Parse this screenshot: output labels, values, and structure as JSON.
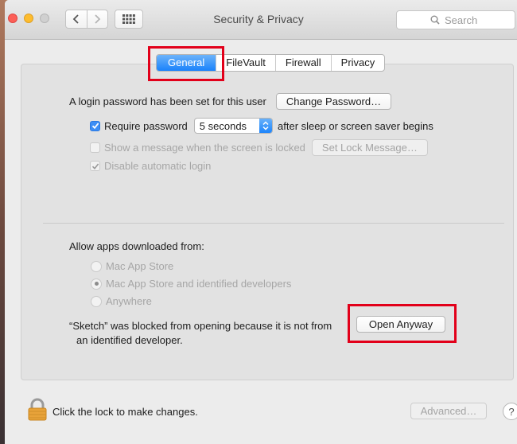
{
  "window": {
    "title": "Security & Privacy"
  },
  "search": {
    "placeholder": "Search"
  },
  "tabs": [
    {
      "label": "General"
    },
    {
      "label": "FileVault"
    },
    {
      "label": "Firewall"
    },
    {
      "label": "Privacy"
    }
  ],
  "general": {
    "login_text": "A login password has been set for this user",
    "change_password_label": "Change Password…",
    "require_password_label": "Require password",
    "require_password_value": "5 seconds",
    "after_sleep_label": "after sleep or screen saver begins",
    "show_message_label": "Show a message when the screen is locked",
    "set_lock_message_label": "Set Lock Message…",
    "disable_auto_login_label": "Disable automatic login"
  },
  "apps": {
    "allow_label": "Allow apps downloaded from:",
    "options": [
      {
        "label": "Mac App Store"
      },
      {
        "label": "Mac App Store and identified developers"
      },
      {
        "label": "Anywhere"
      }
    ],
    "blocked_line1": "“Sketch” was blocked from opening because it is not from",
    "blocked_line2": "an identified developer.",
    "open_anyway_label": "Open Anyway"
  },
  "footer": {
    "lock_text": "Click the lock to make changes.",
    "advanced_label": "Advanced…",
    "help_label": "?"
  },
  "colors": {
    "accent": "#1a82fb",
    "highlight": "#e2001a",
    "lock": "#e8a33a"
  }
}
